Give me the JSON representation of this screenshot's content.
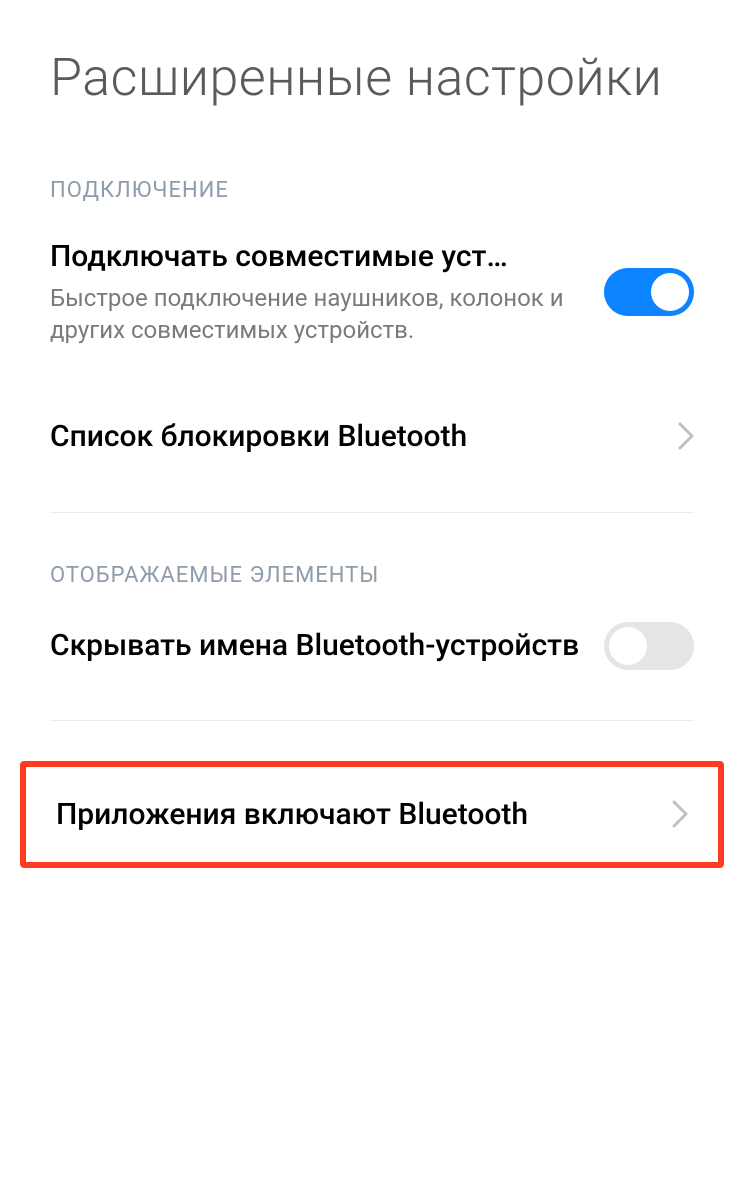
{
  "pageTitle": "Расширенные настройки",
  "sections": {
    "connection": {
      "header": "ПОДКЛЮЧЕНИЕ",
      "items": {
        "compatibleDevices": {
          "title": "Подключать совместимые уст…",
          "description": "Быстрое подключение наушников, колонок и других совместимых устройств.",
          "toggleOn": true
        },
        "blocklist": {
          "title": "Список блокировки Bluetooth"
        }
      }
    },
    "displayed": {
      "header": "ОТОБРАЖАЕМЫЕ ЭЛЕМЕНТЫ",
      "items": {
        "hideNames": {
          "title": "Скрывать имена Bluetooth-устройств",
          "toggleOn": false
        },
        "appsEnable": {
          "title": "Приложения включают Bluetooth"
        }
      }
    }
  },
  "colors": {
    "accent": "#0d84ff",
    "highlight": "#ff3b1f"
  }
}
